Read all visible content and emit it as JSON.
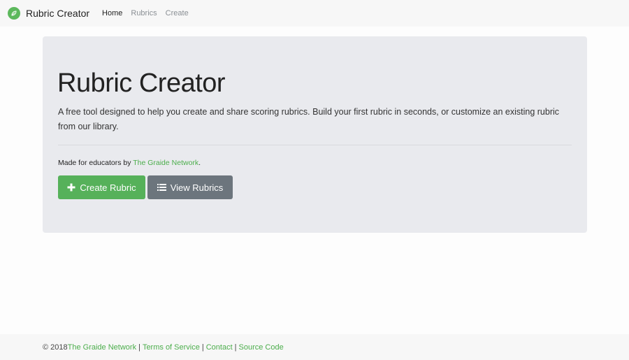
{
  "navbar": {
    "brand": "Rubric Creator",
    "links": [
      "Home",
      "Rubrics",
      "Create"
    ]
  },
  "jumbotron": {
    "title": "Rubric Creator",
    "lead": "A free tool designed to help you create and share scoring rubrics. Build your first rubric in seconds, or customize an existing rubric from our library.",
    "made_for_prefix": "Made for educators by ",
    "made_for_link": "The Graide Network",
    "made_for_suffix": ".",
    "create_button": "Create Rubric",
    "view_button": "View Rubrics"
  },
  "footer": {
    "copyright": "© 2018 ",
    "links": [
      "The Graide Network",
      "Terms of Service",
      "Contact",
      "Source Code"
    ],
    "separator": "|"
  },
  "colors": {
    "accent_green": "#56b15a",
    "secondary_gray": "#6c757d",
    "jumbotron_bg": "#e9eaee"
  },
  "icons": {
    "brand": "leaf-icon",
    "create": "plus-icon",
    "view": "list-icon"
  }
}
